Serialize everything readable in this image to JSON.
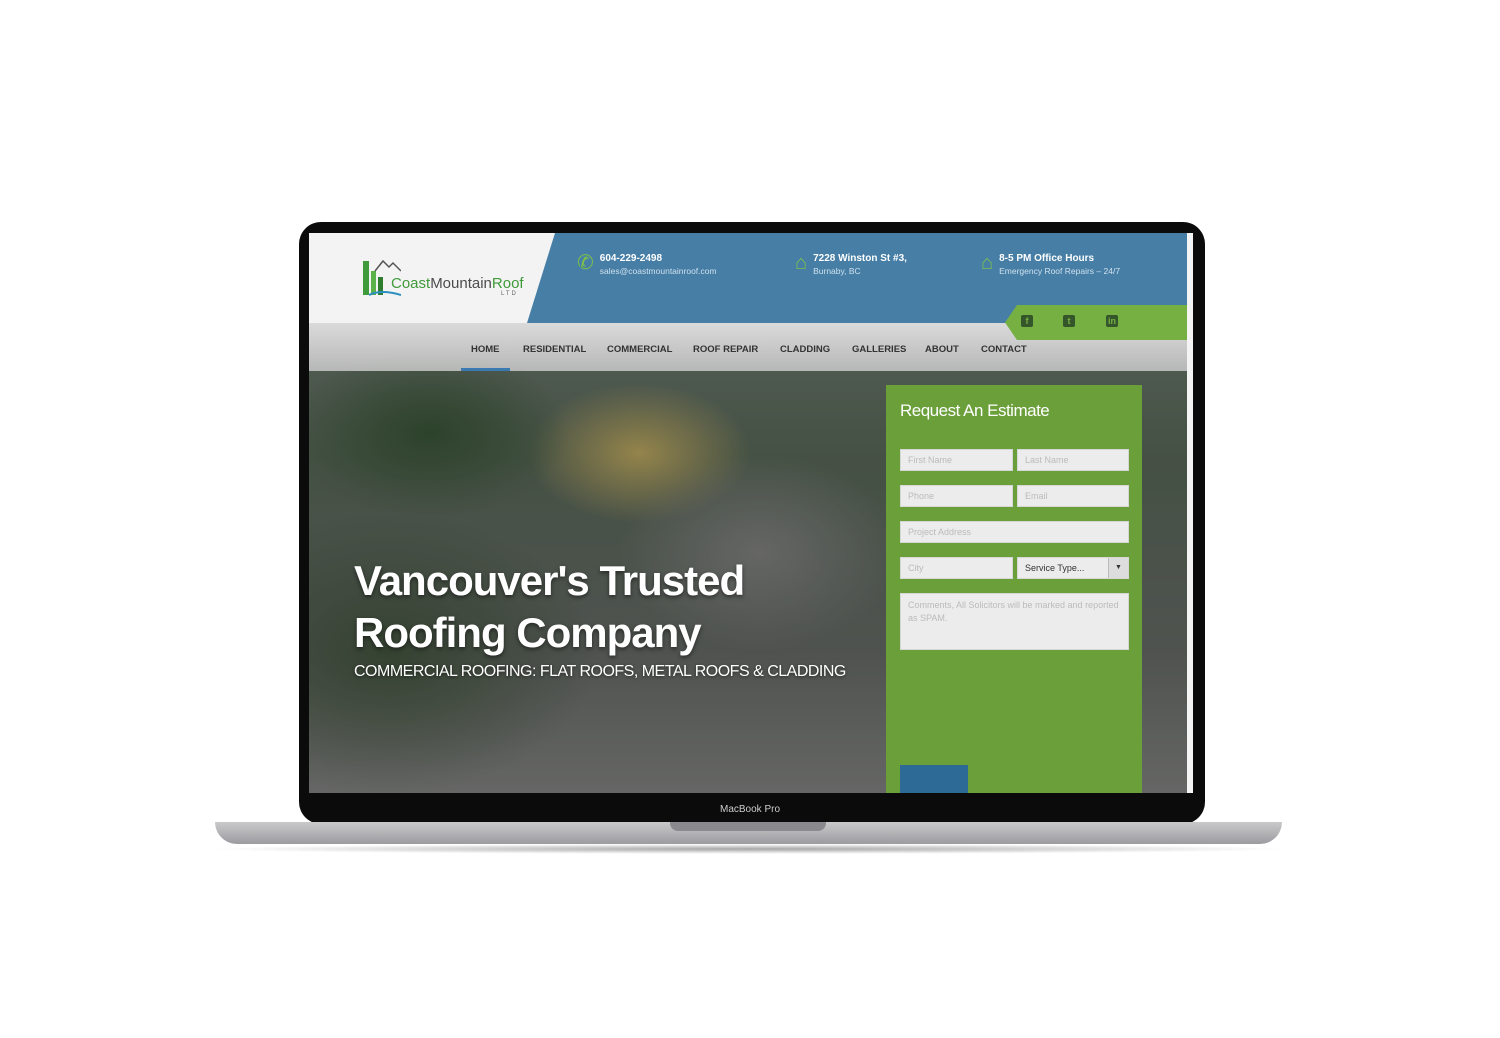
{
  "device": {
    "label": "MacBook Pro"
  },
  "logo": {
    "text_coast": "Coast",
    "text_mountain": "Mountain",
    "text_roof": "Roof",
    "text_ltd": "LTD"
  },
  "contact": [
    {
      "icon": "phone-icon",
      "line1": "604-229-2498",
      "line2": "sales@coastmountainroof.com"
    },
    {
      "icon": "house-icon",
      "line1": "7228 Winston St #3,",
      "line2": "Burnaby, BC"
    },
    {
      "icon": "house-icon",
      "line1": "8-5 PM Office Hours",
      "line2": "Emergency Roof Repairs – 24/7"
    }
  ],
  "social": {
    "facebook": "f",
    "twitter": "t",
    "linkedin": "in"
  },
  "nav": {
    "items": [
      "HOME",
      "RESIDENTIAL",
      "COMMERCIAL",
      "ROOF REPAIR",
      "CLADDING",
      "GALLERIES",
      "ABOUT",
      "CONTACT"
    ],
    "active": "HOME"
  },
  "hero": {
    "title_line1": "Vancouver's Trusted",
    "title_line2": "Roofing Company",
    "subtitle": "COMMERCIAL ROOFING: FLAT ROOFS, METAL ROOFS & CLADDING"
  },
  "form": {
    "title": "Request An Estimate",
    "first_name": "First Name",
    "last_name": "Last Name",
    "phone": "Phone",
    "email": "Email",
    "address": "Project Address",
    "city": "City",
    "service_type": "Service Type...",
    "comments": "Comments, All Solicitors will be marked and reported as SPAM."
  },
  "colors": {
    "blue": "#467ea6",
    "green": "#6a9f3a",
    "accent_green": "#76b043"
  }
}
